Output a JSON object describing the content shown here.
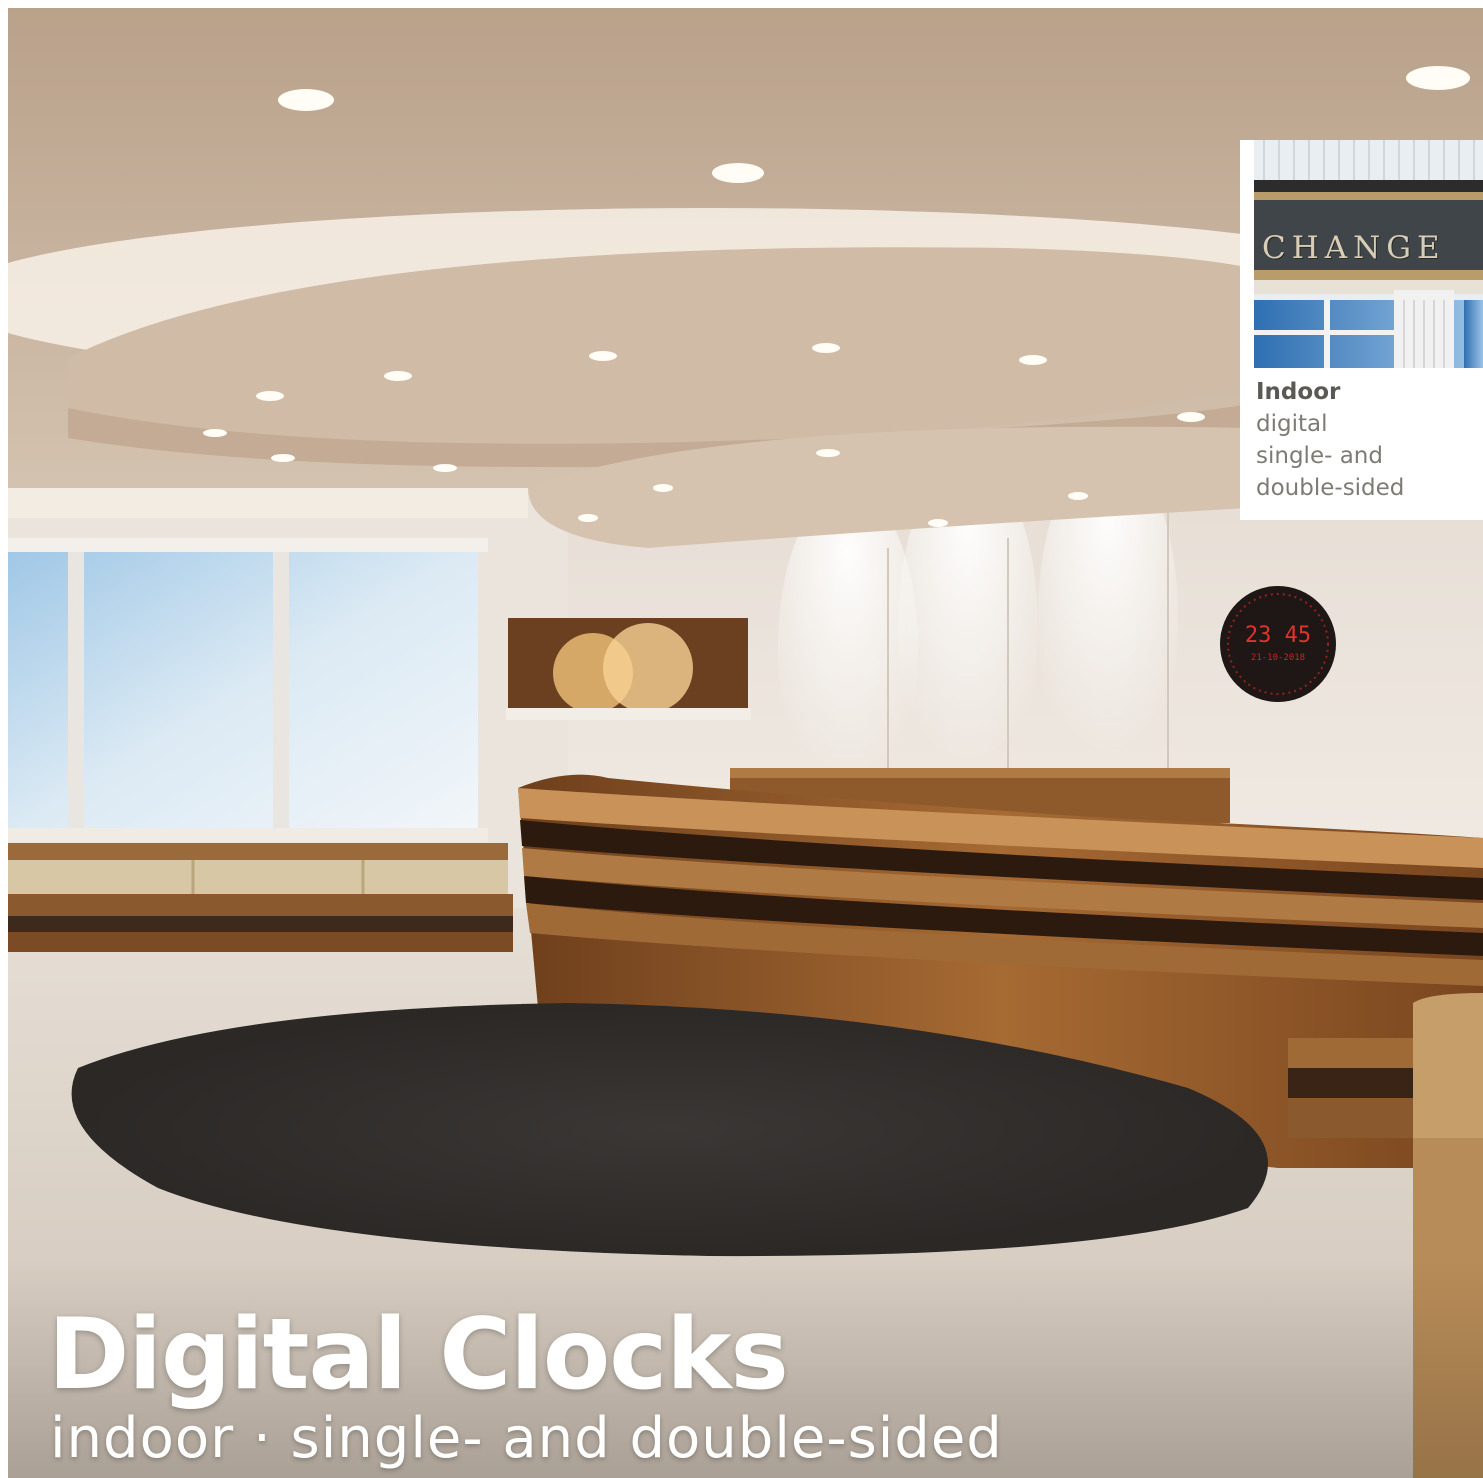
{
  "headline": "Digital Clocks",
  "subheadline": "indoor · single- and double-sided",
  "inset": {
    "photo_word": "CHANGE",
    "title": "Indoor",
    "line1": "digital",
    "line2": "single- and",
    "line3": "double-sided"
  },
  "wall_clock": {
    "time": "23 45",
    "date": "21-10-2018"
  }
}
